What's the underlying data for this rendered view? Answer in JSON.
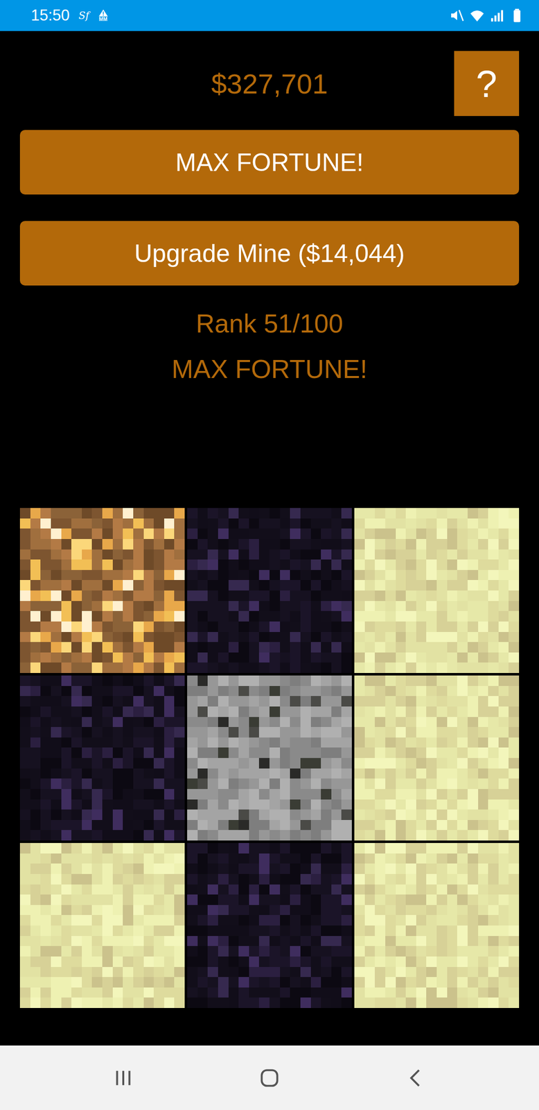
{
  "status_bar": {
    "time": "15:50",
    "notifications": [
      "Sf",
      "MM"
    ]
  },
  "money": "$327,701",
  "help_button": "?",
  "buttons": [
    {
      "label": "MAX FORTUNE!"
    },
    {
      "label": "Upgrade Mine ($14,044)"
    }
  ],
  "rank": "Rank 51/100",
  "status": "MAX FORTUNE!",
  "mine": [
    {
      "kind": "gold"
    },
    {
      "kind": "obsidian"
    },
    {
      "kind": "sand"
    },
    {
      "kind": "obsidian"
    },
    {
      "kind": "coal"
    },
    {
      "kind": "sand"
    },
    {
      "kind": "sand"
    },
    {
      "kind": "obsidian"
    },
    {
      "kind": "sand"
    }
  ]
}
